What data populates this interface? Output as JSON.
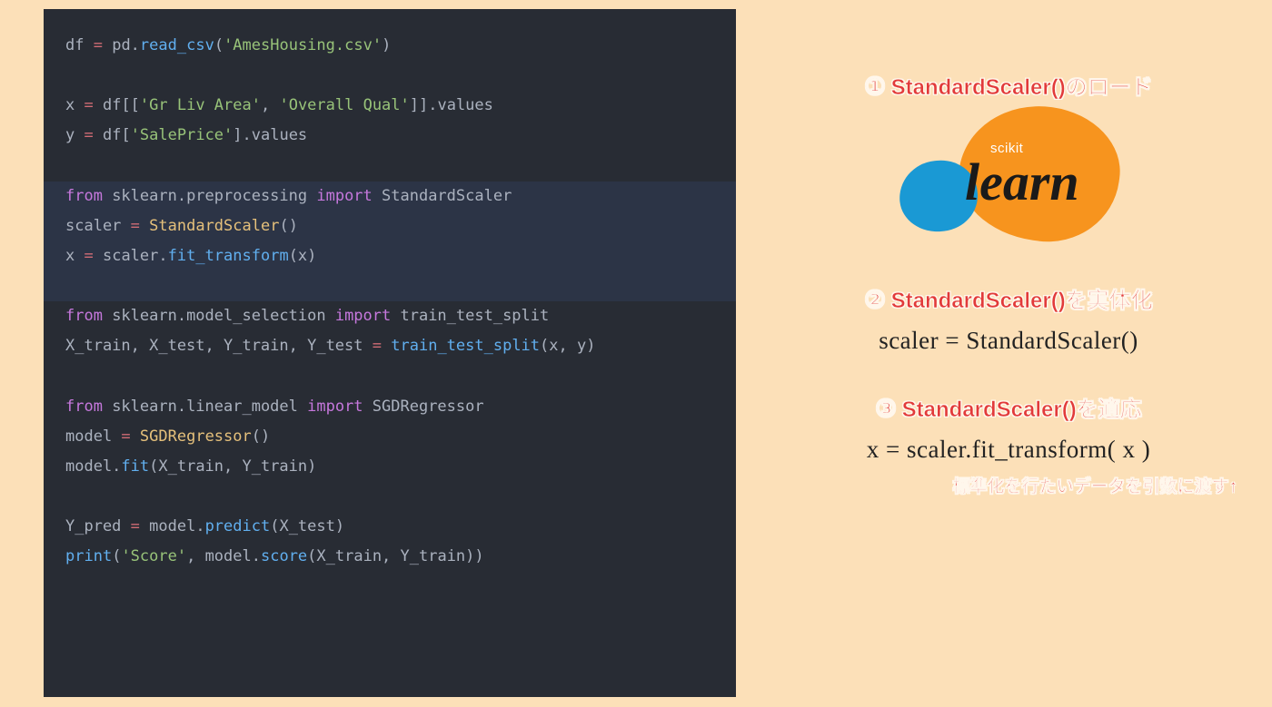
{
  "code": {
    "block1_l1_a": "df ",
    "block1_l1_b": "=",
    "block1_l1_c": " pd.",
    "block1_l1_d": "read_csv",
    "block1_l1_e": "(",
    "block1_l1_f": "'AmesHousing.csv'",
    "block1_l1_g": ")",
    "block1_blank1": " ",
    "block1_l2_a": "x ",
    "block1_l2_b": "=",
    "block1_l2_c": " df[[",
    "block1_l2_d": "'Gr Liv Area'",
    "block1_l2_e": ", ",
    "block1_l2_f": "'Overall Qual'",
    "block1_l2_g": "]].values",
    "block1_l3_a": "y ",
    "block1_l3_b": "=",
    "block1_l3_c": " df[",
    "block1_l3_d": "'SalePrice'",
    "block1_l3_e": "].values",
    "block1_blank2": " ",
    "block2_l1_a": "from",
    "block2_l1_b": " sklearn.preprocessing ",
    "block2_l1_c": "import",
    "block2_l1_d": " StandardScaler",
    "block2_l2_a": "scaler ",
    "block2_l2_b": "=",
    "block2_l2_c": " ",
    "block2_l2_d": "StandardScaler",
    "block2_l2_e": "()",
    "block2_l3_a": "x ",
    "block2_l3_b": "=",
    "block2_l3_c": " scaler.",
    "block2_l3_d": "fit_transform",
    "block2_l3_e": "(x)",
    "block2_blank": " ",
    "block3_l1_a": "from",
    "block3_l1_b": " sklearn.model_selection ",
    "block3_l1_c": "import",
    "block3_l1_d": " train_test_split",
    "block3_l2_a": "X_train, X_test, Y_train, Y_test ",
    "block3_l2_b": "=",
    "block3_l2_c": " ",
    "block3_l2_d": "train_test_split",
    "block3_l2_e": "(x, y)",
    "block3_blank1": " ",
    "block3_l3_a": "from",
    "block3_l3_b": " sklearn.linear_model ",
    "block3_l3_c": "import",
    "block3_l3_d": " SGDRegressor",
    "block3_l4_a": "model ",
    "block3_l4_b": "=",
    "block3_l4_c": " ",
    "block3_l4_d": "SGDRegressor",
    "block3_l4_e": "()",
    "block3_l5_a": "model.",
    "block3_l5_b": "fit",
    "block3_l5_c": "(X_train, Y_train)",
    "block3_blank2": " ",
    "block3_l6_a": "Y_pred ",
    "block3_l6_b": "=",
    "block3_l6_c": " model.",
    "block3_l6_d": "predict",
    "block3_l6_e": "(X_test)",
    "block3_l7_a": "print",
    "block3_l7_b": "(",
    "block3_l7_c": "'Score'",
    "block3_l7_d": ", model.",
    "block3_l7_e": "score",
    "block3_l7_f": "(X_train, Y_train))"
  },
  "right": {
    "step1_num": "①",
    "step1_text": "StandardScaler()のロード",
    "logo_scikit": "scikit",
    "logo_learn": "learn",
    "step2_num": "②",
    "step2_text": "StandardScaler()を実体化",
    "step2_code": "scaler = StandardScaler()",
    "step3_num": "③",
    "step3_text": "StandardScaler()を適応",
    "step3_code": "x =  scaler.fit_transform( x )",
    "step3_note": "標準化を行たいデータを引数に渡す↑"
  }
}
